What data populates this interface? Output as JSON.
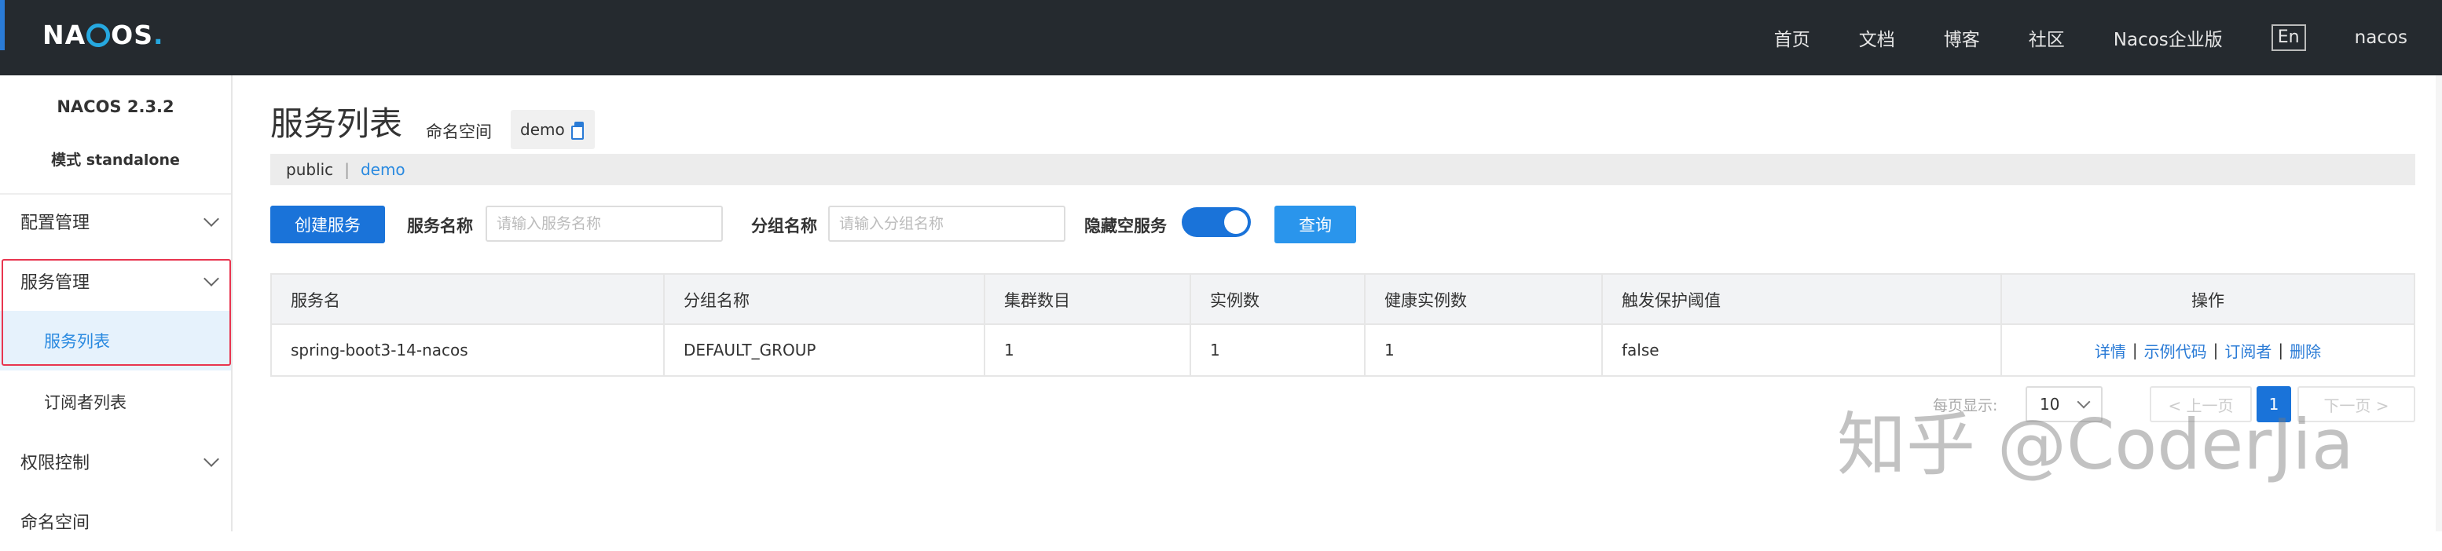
{
  "header": {
    "logo_text": "NACOS.",
    "nav": [
      "首页",
      "文档",
      "博客",
      "社区",
      "Nacos企业版"
    ],
    "lang": "En",
    "user": "nacos"
  },
  "sidebar": {
    "version": "NACOS 2.3.2",
    "mode": "模式 standalone",
    "items": [
      {
        "label": "配置管理"
      },
      {
        "label": "服务管理"
      },
      {
        "label": "服务列表"
      },
      {
        "label": "订阅者列表"
      },
      {
        "label": "权限控制"
      },
      {
        "label": "命名空间"
      }
    ]
  },
  "main": {
    "title": "服务列表",
    "namespace_label": "命名空间",
    "namespace_value": "demo",
    "ns_tabs": {
      "public": "public",
      "sep": "|",
      "demo": "demo"
    },
    "filters": {
      "create_button": "创建服务",
      "service_name_label": "服务名称",
      "service_name_placeholder": "请输入服务名称",
      "group_name_label": "分组名称",
      "group_name_placeholder": "请输入分组名称",
      "hide_empty_label": "隐藏空服务",
      "hide_empty_on": true,
      "query_button": "查询"
    },
    "table": {
      "columns": [
        "服务名",
        "分组名称",
        "集群数目",
        "实例数",
        "健康实例数",
        "触发保护阈值",
        "操作"
      ],
      "rows": [
        {
          "service": "spring-boot3-14-nacos",
          "group": "DEFAULT_GROUP",
          "clusters": "1",
          "instances": "1",
          "healthy": "1",
          "threshold": "false",
          "ops": [
            "详情",
            "示例代码",
            "订阅者",
            "删除"
          ]
        }
      ]
    },
    "pagination": {
      "per_page_label": "每页显示:",
      "per_page": "10",
      "prev": "< 上一页",
      "current": "1",
      "next": "下一页 >"
    }
  },
  "watermark": "知乎 @CoderJia",
  "colors": {
    "header_bg": "#252a2f",
    "primary": "#1a73d9",
    "link": "#2a7bd6",
    "highlight": "#e8354f"
  }
}
